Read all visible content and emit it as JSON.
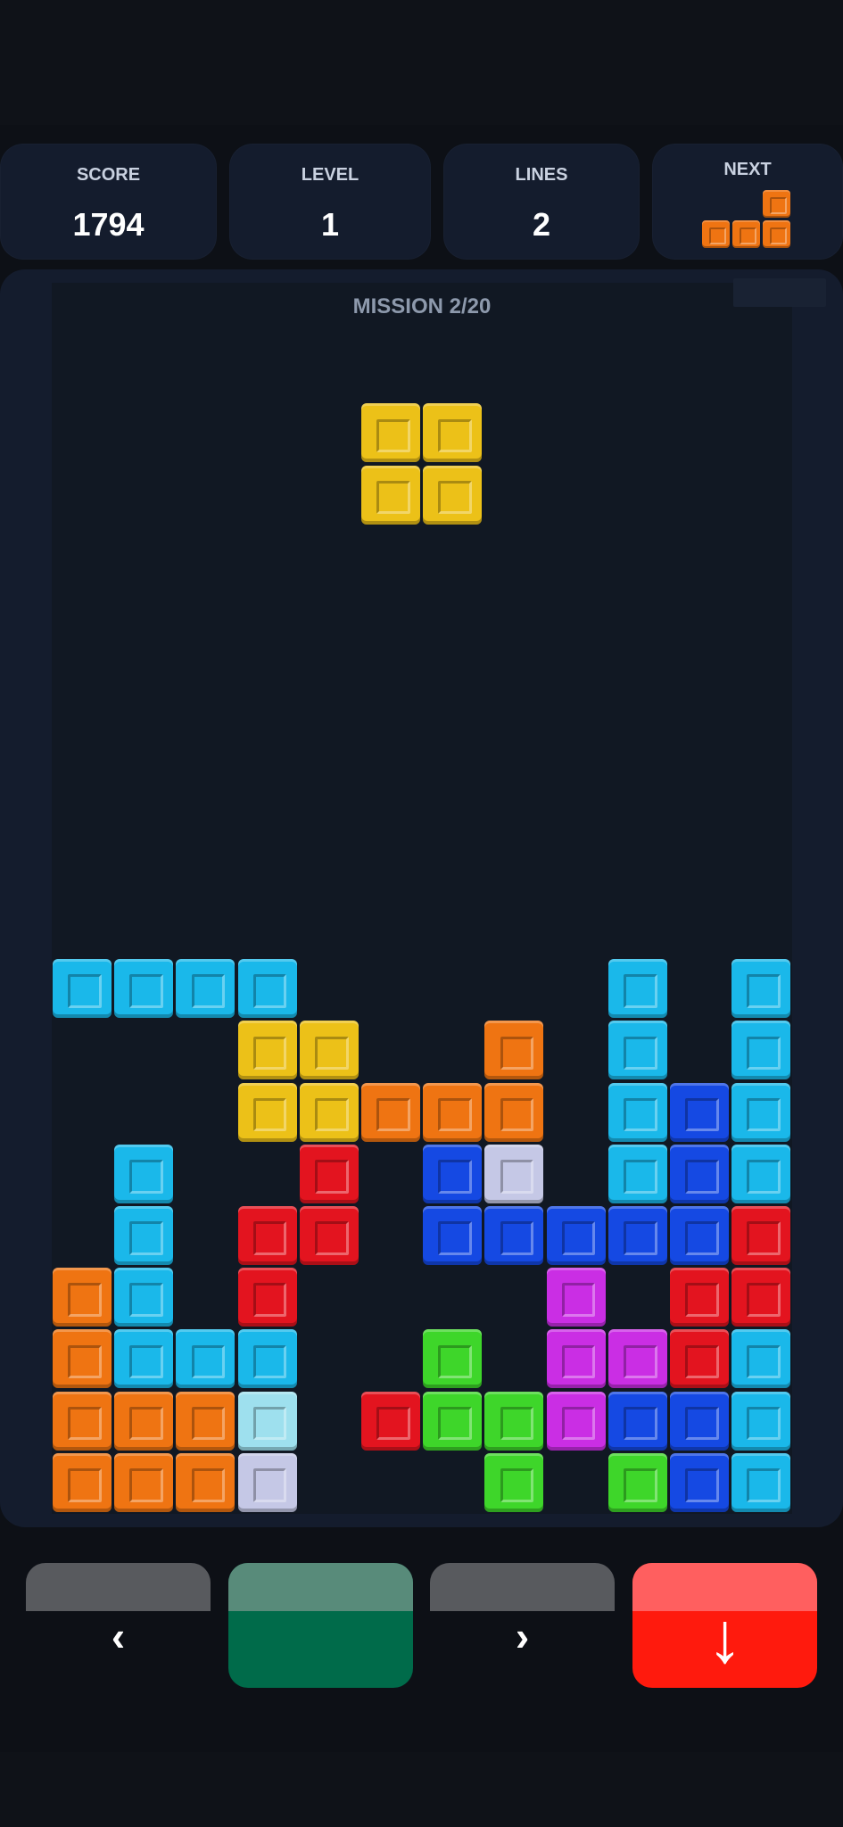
{
  "stats": {
    "score_label": "SCORE",
    "score_value": "1794",
    "level_label": "LEVEL",
    "level_value": "1",
    "lines_label": "LINES",
    "lines_value": "2",
    "next_label": "NEXT"
  },
  "mission": "MISSION 2/20",
  "colors": {
    "C": "#1ab8ea",
    "Y": "#ecc118",
    "O": "#ef7412",
    "R": "#e3141f",
    "B": "#1549e3",
    "G": "#3ed62a",
    "P": "#ca2ee4",
    "W": "#c5c8e6",
    "L": "#9ee0ee"
  },
  "board": {
    "columns": 12,
    "rows": [
      "C C C C . . . . . C . C",
      ". . . Y Y . . O . C . C",
      ". . . Y Y O O O . C B C",
      ". C . . R . B W . C B C",
      ". C . R R . B B B B B R",
      "O C . R . . . . P . R R",
      "O C C C . . G . P P R C",
      "O O O L . R G G P B B C",
      "O O O W . . . G . G B C"
    ]
  },
  "active_piece": {
    "type": "O",
    "color": "Y",
    "col": 5,
    "row": -9
  },
  "next_piece": {
    "type": "L",
    "color": "O"
  },
  "controls": {
    "left_glyph": "‹",
    "right_glyph": "›",
    "drop_glyph": "↓",
    "rotate_glyph": ""
  }
}
